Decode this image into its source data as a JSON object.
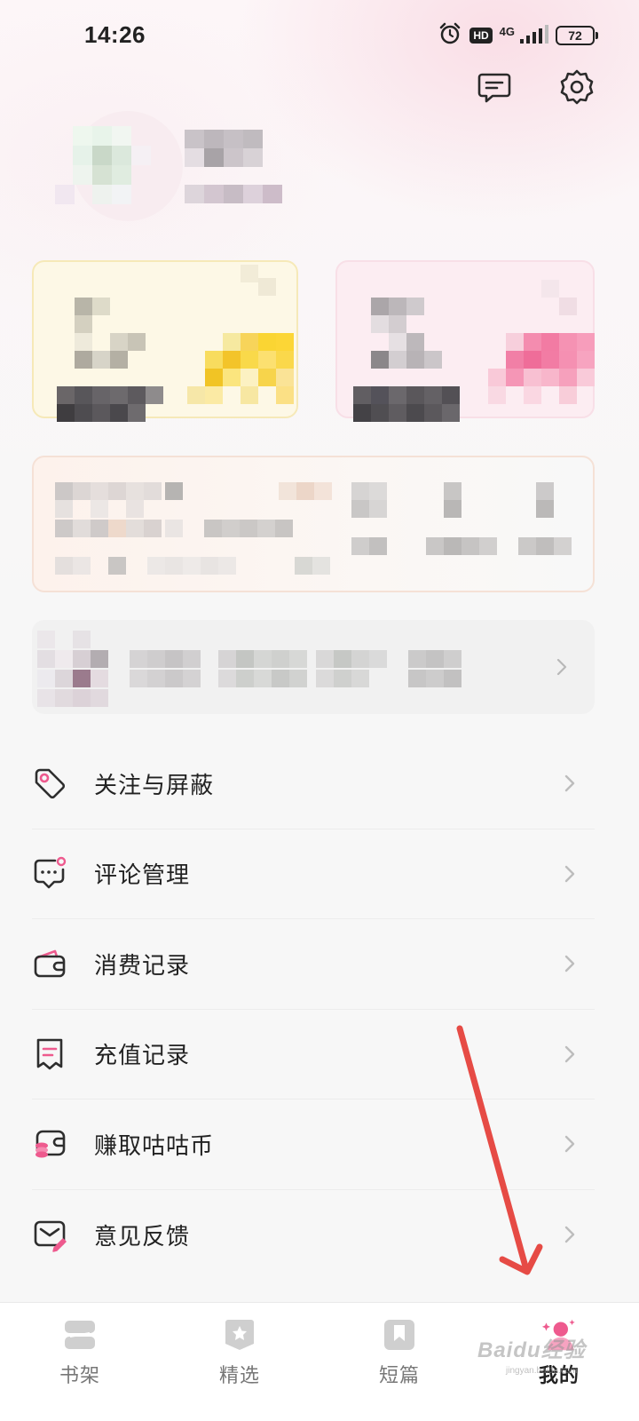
{
  "status_bar": {
    "time": "14:26",
    "hd": "HD",
    "network": "4G",
    "battery": "72",
    "icons": [
      "alarm-icon",
      "signal-icon"
    ]
  },
  "header": {
    "icons": [
      "message-icon",
      "settings-icon"
    ]
  },
  "menu": [
    {
      "label": "关注与屏蔽",
      "icon": "tag-icon"
    },
    {
      "label": "评论管理",
      "icon": "comment-icon"
    },
    {
      "label": "消费记录",
      "icon": "wallet-icon"
    },
    {
      "label": "充值记录",
      "icon": "receipt-icon"
    },
    {
      "label": "赚取咕咕币",
      "icon": "coins-icon"
    },
    {
      "label": "意见反馈",
      "icon": "feedback-icon"
    }
  ],
  "bottom_nav": [
    {
      "label": "书架",
      "icon": "bookshelf-icon"
    },
    {
      "label": "精选",
      "icon": "star-badge-icon"
    },
    {
      "label": "短篇",
      "icon": "bookmark-icon"
    },
    {
      "label": "我的",
      "icon": "profile-sparkle-icon",
      "active": true
    }
  ],
  "watermark": {
    "text": "Baidu经验",
    "sub": "jingyan.baidu.com"
  },
  "colors": {
    "accent": "#ee5a8e",
    "annotation_arrow": "#e64b45",
    "card_yellow": "#fdf7e3",
    "card_pink": "#fcebf0"
  }
}
